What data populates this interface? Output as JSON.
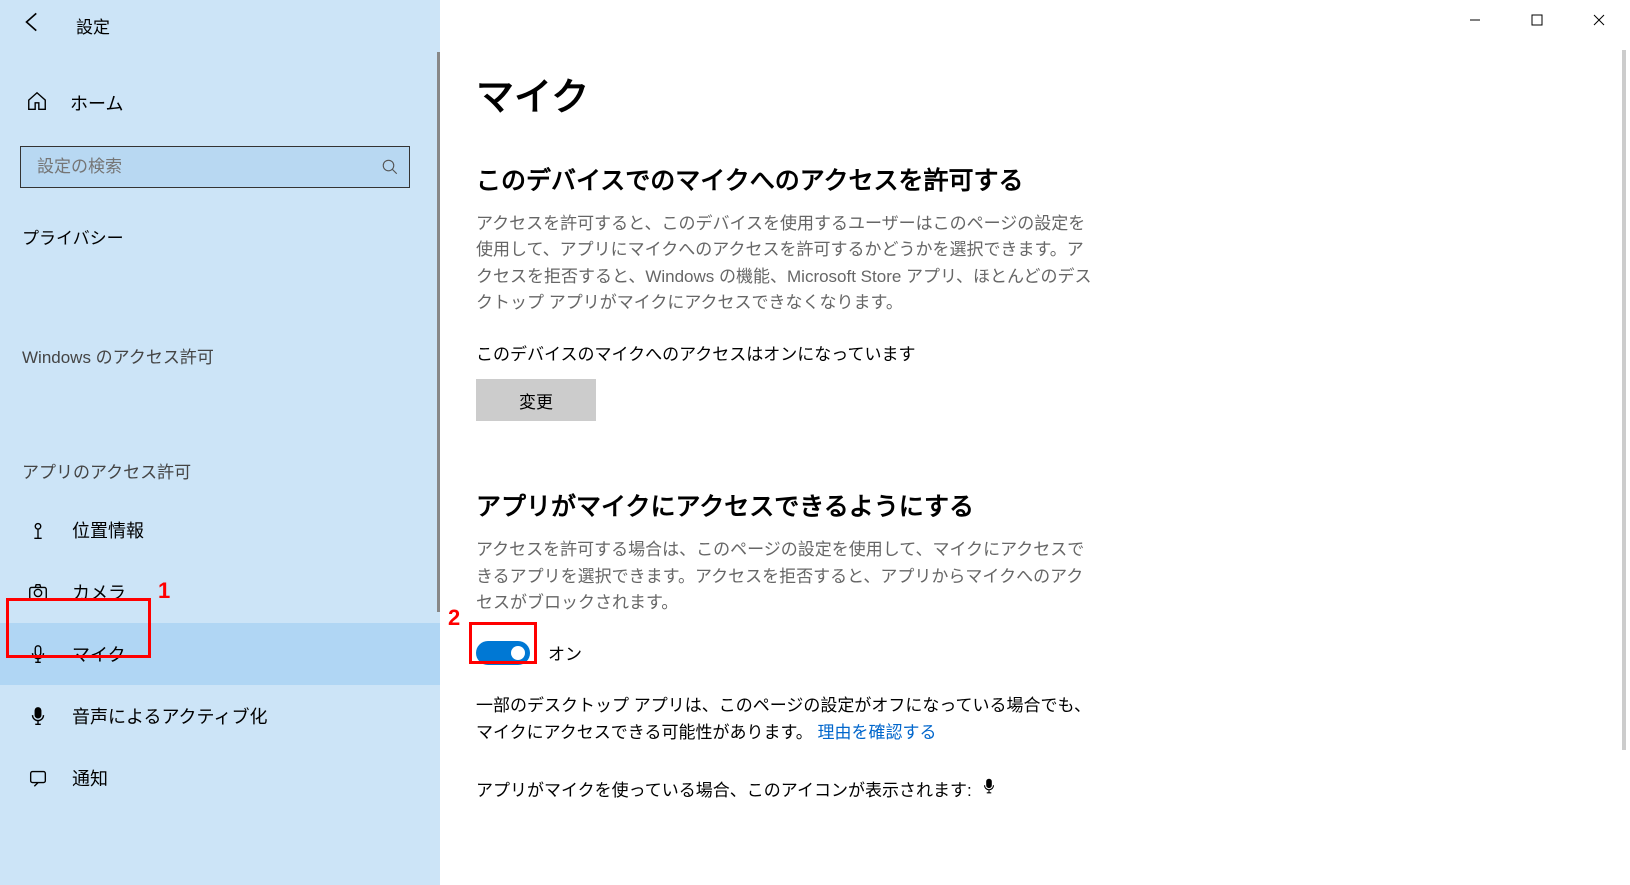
{
  "window": {
    "title": "設定"
  },
  "sidebar": {
    "home": "ホーム",
    "search_placeholder": "設定の検索",
    "category": "プライバシー",
    "group1": "Windows のアクセス許可",
    "group2": "アプリのアクセス許可",
    "items": {
      "location": "位置情報",
      "camera": "カメラ",
      "microphone": "マイク",
      "voice": "音声によるアクティブ化",
      "notifications": "通知"
    }
  },
  "main": {
    "title": "マイク",
    "section1": {
      "heading": "このデバイスでのマイクへのアクセスを許可する",
      "desc": "アクセスを許可すると、このデバイスを使用するユーザーはこのページの設定を使用して、アプリにマイクへのアクセスを許可するかどうかを選択できます。アクセスを拒否すると、Windows の機能、Microsoft Store アプリ、ほとんどのデスクトップ アプリがマイクにアクセスできなくなります。",
      "status": "このデバイスのマイクへのアクセスはオンになっています",
      "change_btn": "変更"
    },
    "section2": {
      "heading": "アプリがマイクにアクセスできるようにする",
      "desc": "アクセスを許可する場合は、このページの設定を使用して、マイクにアクセスできるアプリを選択できます。アクセスを拒否すると、アプリからマイクへのアクセスがブロックされます。",
      "toggle_label": "オン",
      "note_prefix": "一部のデスクトップ アプリは、このページの設定がオフになっている場合でも、マイクにアクセスできる可能性があります。",
      "note_link": "理由を確認する",
      "indicator": "アプリがマイクを使っている場合、このアイコンが表示されます:"
    }
  },
  "annotations": {
    "n1": "1",
    "n2": "2"
  }
}
